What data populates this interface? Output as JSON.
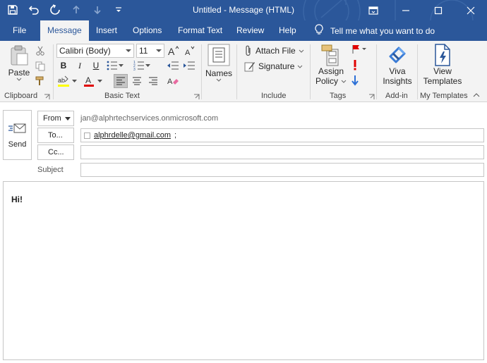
{
  "window": {
    "title": "Untitled  -  Message (HTML)",
    "accent": "#2b579a"
  },
  "quick_access": [
    {
      "icon": "save-icon"
    },
    {
      "icon": "undo-icon"
    },
    {
      "icon": "redo-icon"
    },
    {
      "icon": "arrow-up-icon"
    },
    {
      "icon": "arrow-down-icon"
    },
    {
      "icon": "customize-toolbar-icon"
    }
  ],
  "tabs": {
    "file": "File",
    "message": "Message",
    "insert": "Insert",
    "options": "Options",
    "format_text": "Format Text",
    "review": "Review",
    "help": "Help"
  },
  "tell_me": "Tell me what you want to do",
  "ribbon": {
    "clipboard": {
      "label": "Clipboard",
      "paste": "Paste"
    },
    "basic_text": {
      "label": "Basic Text",
      "font": "Calibri (Body)",
      "size": "11",
      "bold": "B",
      "italic": "I",
      "underline": "U"
    },
    "names": {
      "label": "Names"
    },
    "include": {
      "label": "Include",
      "attach_file": "Attach File",
      "signature": "Signature"
    },
    "tags": {
      "label": "Tags",
      "assign_policy_line1": "Assign",
      "assign_policy_line2": "Policy"
    },
    "addin": {
      "label": "Add-in",
      "viva_line1": "Viva",
      "viva_line2": "Insights"
    },
    "templates": {
      "label": "My Templates",
      "view_line1": "View",
      "view_line2": "Templates"
    }
  },
  "compose": {
    "send": "Send",
    "from_label": "From",
    "from_address": "jan@alphrtechservices.onmicrosoft.com",
    "to_label": "To...",
    "to_recipient": "alphrdelle@gmail.com",
    "to_sep": ";",
    "cc_label": "Cc...",
    "cc_value": "",
    "subject_label": "Subject",
    "subject_value": "",
    "body_text": "Hi!"
  }
}
